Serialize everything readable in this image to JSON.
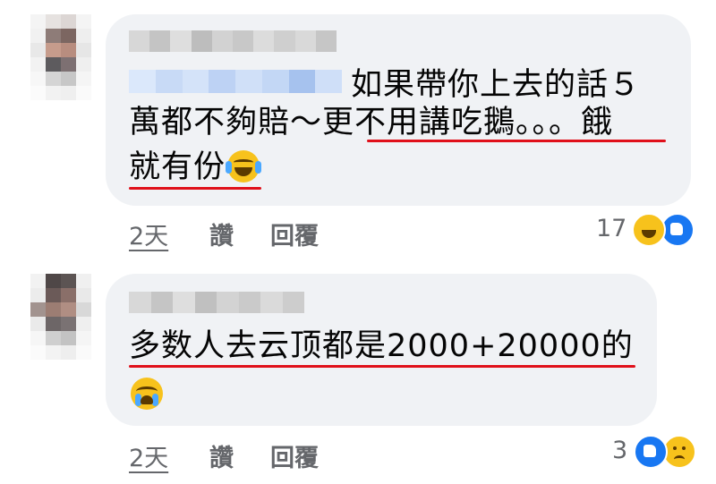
{
  "comments": [
    {
      "lines": [
        "如果帶你上去的話５",
        "萬都不夠賠～更不用講吃鵝。。。餓",
        "就有份"
      ],
      "time": "2天",
      "like_label": "讚",
      "reply_label": "回覆",
      "reaction_count": "17",
      "reactions": [
        "haha-icon",
        "like-icon"
      ]
    },
    {
      "lines": [
        "多数人去云顶都是2000+20000的"
      ],
      "time": "2天",
      "like_label": "讚",
      "reply_label": "回覆",
      "reaction_count": "3",
      "reactions": [
        "like-icon",
        "sad-icon"
      ]
    }
  ],
  "colors": {
    "bubble": "#f0f2f5",
    "meta_text": "#65676b",
    "underline": "#e0101a",
    "like_blue": "#1877f2",
    "emoji_yellow": "#f7c21c"
  }
}
